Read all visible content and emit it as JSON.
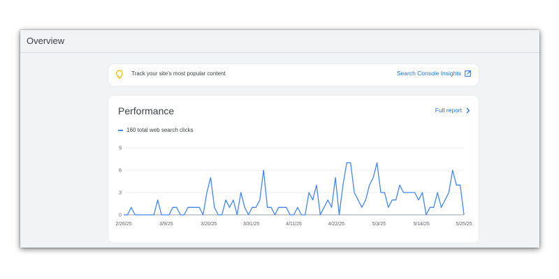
{
  "header": {
    "title": "Overview"
  },
  "banner": {
    "text": "Track your site's most popular content",
    "link_label": "Search Console Insights",
    "icon": "lightbulb-icon",
    "link_icon": "open-in-new-icon"
  },
  "performance": {
    "title": "Performance",
    "full_report_label": "Full report",
    "legend_label": "160 total web search clicks"
  },
  "colors": {
    "line": "#4285f4",
    "link": "#1a73e8",
    "bulb": "#fbbc04"
  },
  "chart_data": {
    "type": "line",
    "title": "",
    "xlabel": "",
    "ylabel": "",
    "ylim": [
      0,
      9
    ],
    "yticks": [
      0,
      3,
      6,
      9
    ],
    "xtick_labels": [
      "2/26/25",
      "3/9/25",
      "3/20/25",
      "3/31/25",
      "4/11/25",
      "4/22/25",
      "5/3/25",
      "5/14/25",
      "5/25/25"
    ],
    "grid": true,
    "series": [
      {
        "name": "160 total web search clicks",
        "values": [
          0,
          0,
          1,
          0,
          0,
          0,
          0,
          0,
          0,
          2,
          0,
          0,
          0,
          1,
          1,
          0,
          0,
          1,
          1,
          1,
          1,
          0,
          3,
          5,
          1,
          0,
          0,
          2,
          1,
          2,
          0,
          3,
          1,
          0,
          1,
          1,
          2,
          6,
          1,
          1,
          0,
          1,
          1,
          1,
          0,
          0,
          1,
          0,
          0,
          3,
          2,
          4,
          0,
          1,
          2,
          1,
          5,
          0,
          4,
          7,
          7,
          3,
          2,
          1,
          2,
          4,
          5,
          7,
          3,
          3,
          1,
          2,
          2,
          4,
          3,
          3,
          3,
          3,
          2,
          3,
          0,
          1,
          1,
          3,
          1,
          2,
          3,
          6,
          4,
          4,
          0
        ]
      }
    ]
  }
}
